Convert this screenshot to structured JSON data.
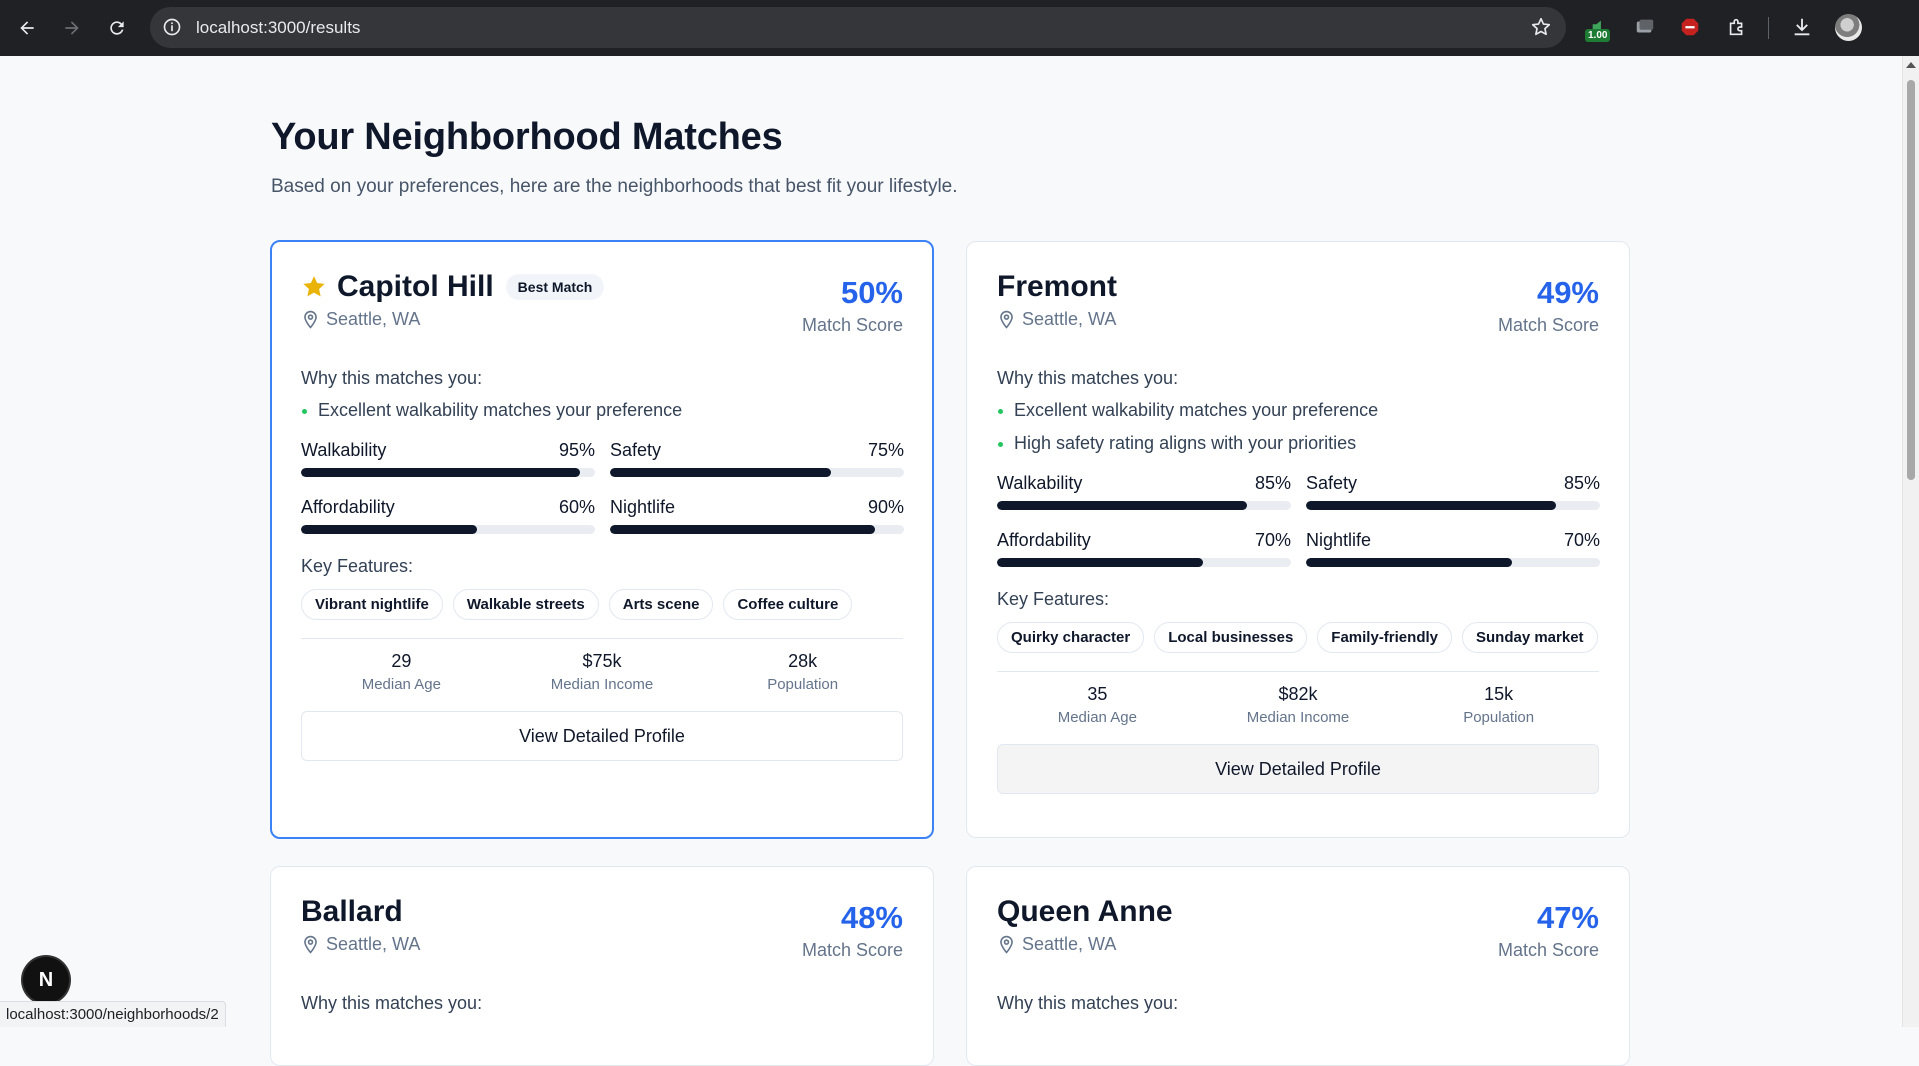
{
  "browser": {
    "url": "localhost:3000/results",
    "extension_badge": "1.00"
  },
  "page": {
    "title": "Your Neighborhood Matches",
    "subtitle": "Based on your preferences, here are the neighborhoods that best fit your lifestyle."
  },
  "labels": {
    "why": "Why this matches you:",
    "key_features": "Key Features:",
    "match_score": "Match Score",
    "median_age": "Median Age",
    "median_income": "Median Income",
    "population": "Population",
    "view_profile": "View Detailed Profile",
    "best_match": "Best Match",
    "walkability": "Walkability",
    "safety": "Safety",
    "affordability": "Affordability",
    "nightlife": "Nightlife"
  },
  "cards": [
    {
      "name": "Capitol Hill",
      "location": "Seattle, WA",
      "score": "50%",
      "reasons": [
        "Excellent walkability matches your preference"
      ],
      "walkability": "95%",
      "walkability_value": 95,
      "safety": "75%",
      "safety_value": 75,
      "affordability": "60%",
      "affordability_value": 60,
      "nightlife": "90%",
      "nightlife_value": 90,
      "features": [
        "Vibrant nightlife",
        "Walkable streets",
        "Arts scene",
        "Coffee culture"
      ],
      "median_age": "29",
      "median_income": "$75k",
      "population": "28k"
    },
    {
      "name": "Fremont",
      "location": "Seattle, WA",
      "score": "49%",
      "reasons": [
        "Excellent walkability matches your preference",
        "High safety rating aligns with your priorities"
      ],
      "walkability": "85%",
      "walkability_value": 85,
      "safety": "85%",
      "safety_value": 85,
      "affordability": "70%",
      "affordability_value": 70,
      "nightlife": "70%",
      "nightlife_value": 70,
      "features": [
        "Quirky character",
        "Local businesses",
        "Family-friendly",
        "Sunday market"
      ],
      "median_age": "35",
      "median_income": "$82k",
      "population": "15k"
    },
    {
      "name": "Ballard",
      "location": "Seattle, WA",
      "score": "48%"
    },
    {
      "name": "Queen Anne",
      "location": "Seattle, WA",
      "score": "47%"
    }
  ],
  "status_bar": "localhost:3000/neighborhoods/2",
  "dev_badge": "N"
}
